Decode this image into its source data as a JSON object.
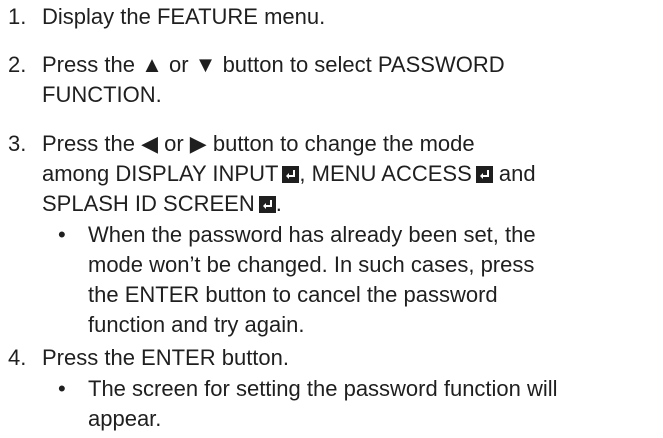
{
  "steps": [
    {
      "number": "1.",
      "lines": [
        "Display the FEATURE menu."
      ]
    },
    {
      "number": "2.",
      "line1_pre": "Press the",
      "up_symbol": "▲",
      "line1_mid": "or",
      "down_symbol": "▼",
      "line1_post": "button to select PASSWORD",
      "line2": "FUNCTION."
    },
    {
      "number": "3.",
      "line1_pre": "Press the",
      "left_symbol": "◀",
      "line1_mid": "or",
      "right_symbol": "▶",
      "line1_post": "button to change the mode",
      "line2_a": "among DISPLAY INPUT",
      "line2_b": ", MENU ACCESS",
      "line2_c": "and",
      "line3_a": "SPLASH ID SCREEN",
      "line3_b": ".",
      "bullet": {
        "symbol": "•",
        "lines": [
          "When the password has already been set, the",
          "mode won’t be changed. In such cases, press",
          "the ENTER button to cancel the password",
          "function and try again."
        ]
      }
    },
    {
      "number": "4.",
      "lines": [
        "Press the ENTER button."
      ],
      "bullet": {
        "symbol": "•",
        "lines": [
          "The screen for setting the password function will",
          "appear."
        ]
      }
    }
  ],
  "icons": {
    "enter": "enter-key-icon"
  }
}
